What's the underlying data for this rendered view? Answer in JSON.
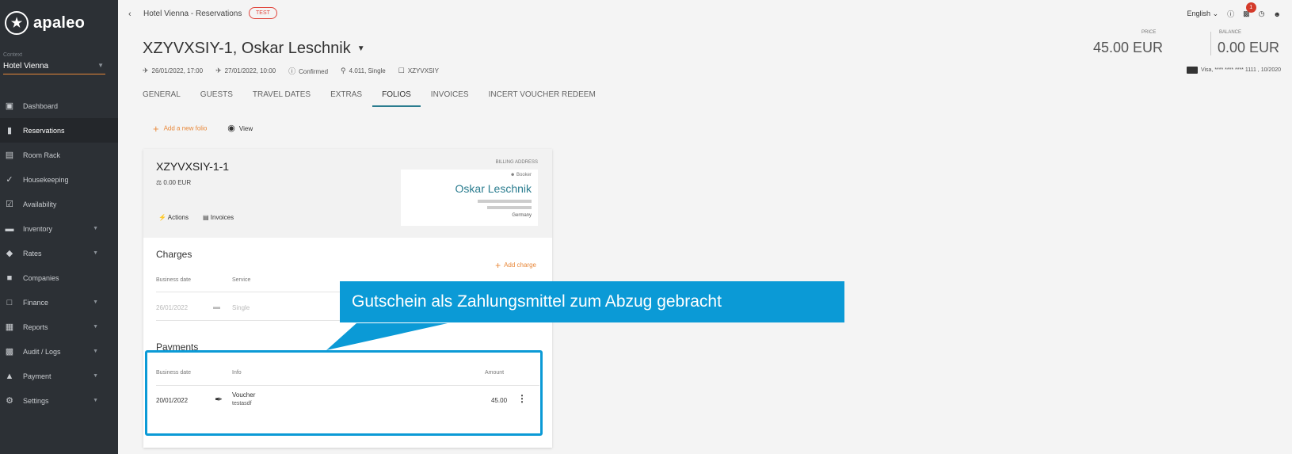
{
  "sidebar": {
    "brand": "apaleo",
    "context_label": "Context",
    "context_value": "Hotel Vienna",
    "items": [
      {
        "label": "Dashboard",
        "icon": "dashboard-icon",
        "has_children": false
      },
      {
        "label": "Reservations",
        "icon": "reservations-icon",
        "has_children": false,
        "active": true
      },
      {
        "label": "Room Rack",
        "icon": "calendar-icon",
        "has_children": false
      },
      {
        "label": "Housekeeping",
        "icon": "broom-icon",
        "has_children": false
      },
      {
        "label": "Availability",
        "icon": "availability-icon",
        "has_children": false
      },
      {
        "label": "Inventory",
        "icon": "bed-icon",
        "has_children": true
      },
      {
        "label": "Rates",
        "icon": "layers-icon",
        "has_children": true
      },
      {
        "label": "Companies",
        "icon": "briefcase-icon",
        "has_children": false
      },
      {
        "label": "Finance",
        "icon": "money-icon",
        "has_children": true
      },
      {
        "label": "Reports",
        "icon": "report-icon",
        "has_children": true
      },
      {
        "label": "Audit / Logs",
        "icon": "audit-icon",
        "has_children": true
      },
      {
        "label": "Payment",
        "icon": "payment-icon",
        "has_children": true
      },
      {
        "label": "Settings",
        "icon": "gear-icon",
        "has_children": true
      }
    ]
  },
  "header": {
    "breadcrumb": "Hotel Vienna - Reservations",
    "test_badge": "TEST",
    "title": "XZYVXSIY-1, Oskar Leschnik",
    "meta": {
      "arrival": "26/01/2022, 17:00",
      "departure": "27/01/2022, 10:00",
      "status": "Confirmed",
      "unit": "4.011, Single",
      "booking": "XZYVXSIY"
    },
    "tabs": [
      "GENERAL",
      "GUESTS",
      "TRAVEL DATES",
      "EXTRAS",
      "FOLIOS",
      "INVOICES",
      "INCERT VOUCHER REDEEM"
    ],
    "active_tab": "FOLIOS",
    "language": "English",
    "notification_count": "1",
    "price_label": "PRICE",
    "price_value": "45.00 EUR",
    "balance_label": "BALANCE",
    "balance_value": "0.00 EUR",
    "card_info": "Visa, **** **** **** 1111 , 10/2020"
  },
  "toolbar": {
    "add_folio": "Add a new folio",
    "view": "View"
  },
  "folio": {
    "id": "XZYVXSIY-1-1",
    "balance": "0.00 EUR",
    "actions_label": "Actions",
    "invoices_label": "Invoices",
    "billing_label": "BILLING ADDRESS",
    "booker_label": "Booker",
    "billing_name": "Oskar Leschnik",
    "billing_country": "Germany"
  },
  "charges": {
    "title": "Charges",
    "add_label": "Add charge",
    "columns": [
      "Business date",
      "Service"
    ],
    "rows": [
      {
        "date": "26/01/2022",
        "service": "Single"
      }
    ]
  },
  "payments": {
    "title": "Payments",
    "columns": [
      "Business date",
      "Info",
      "Amount"
    ],
    "rows": [
      {
        "date": "20/01/2022",
        "info": "Voucher",
        "sub": "testasdf",
        "amount": "45.00"
      }
    ]
  },
  "annotation": {
    "text": "Gutschein als Zahlungsmittel zum Abzug gebracht",
    "color": "#0b9ad6"
  }
}
